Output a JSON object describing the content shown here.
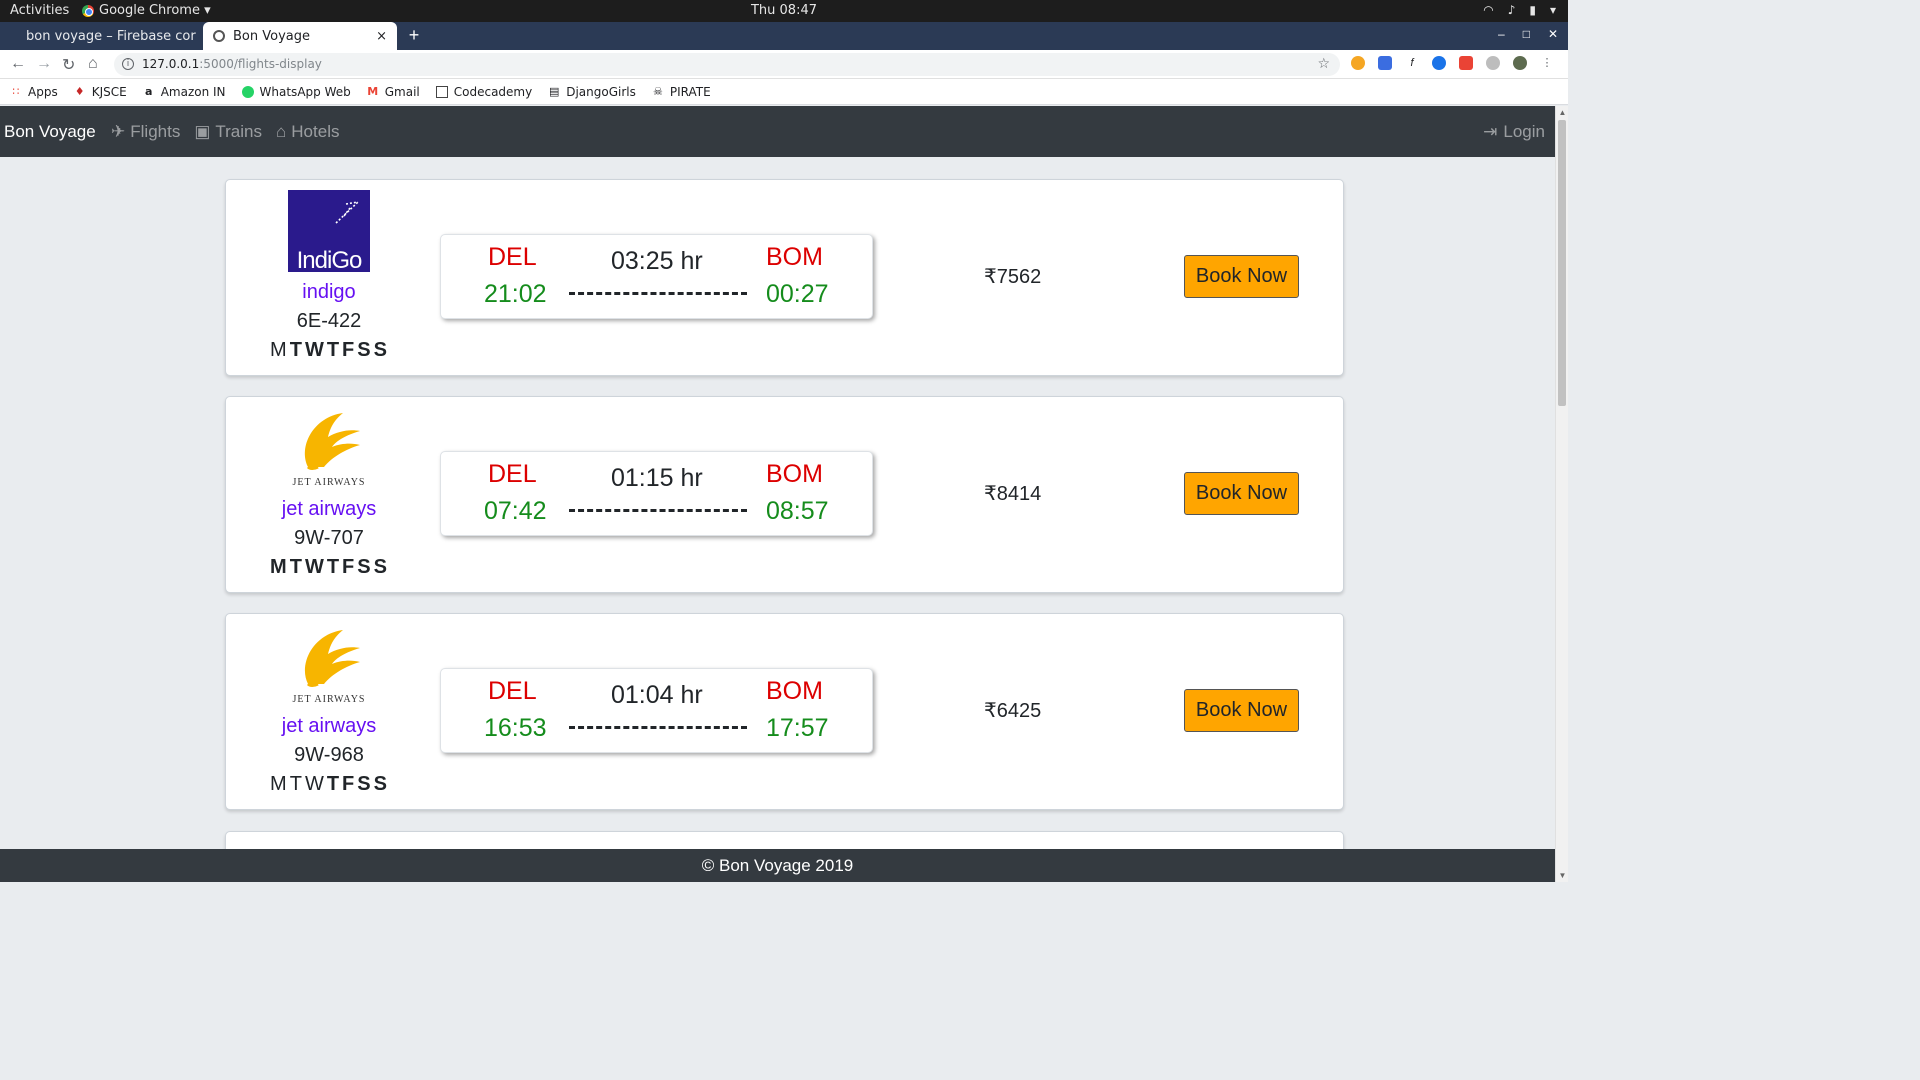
{
  "os_bar": {
    "activities": "Activities",
    "app_name": "Google Chrome ▾",
    "clock": "Thu 08:47"
  },
  "tabs": [
    {
      "title": "bon voyage – Firebase cor",
      "close": "×"
    },
    {
      "title": "Bon Voyage",
      "close": "×"
    }
  ],
  "address_bar": {
    "host": "127.0.0.1",
    "path": ":5000/flights-display"
  },
  "bookmarks": [
    {
      "label": "Apps",
      "icon": "apps-grid-icon"
    },
    {
      "label": "KJSCE",
      "icon": "kjsce-icon"
    },
    {
      "label": "Amazon IN",
      "icon": "amazon-icon"
    },
    {
      "label": "WhatsApp Web",
      "icon": "whatsapp-icon"
    },
    {
      "label": "Gmail",
      "icon": "gmail-icon"
    },
    {
      "label": "Codecademy",
      "icon": "codecademy-icon"
    },
    {
      "label": "DjangoGirls",
      "icon": "book-icon"
    },
    {
      "label": "PIRATE",
      "icon": "pirate-icon"
    }
  ],
  "navbar": {
    "brand": "Bon Voyage",
    "links": [
      {
        "label": "Flights",
        "icon": "plane-icon"
      },
      {
        "label": "Trains",
        "icon": "train-icon"
      },
      {
        "label": "Hotels",
        "icon": "home-icon"
      }
    ],
    "login": "Login"
  },
  "day_letters": [
    "M",
    "T",
    "W",
    "T",
    "F",
    "S",
    "S"
  ],
  "flights": [
    {
      "airline": "indigo",
      "logo": "indigo-logo",
      "logo_text": "IndiGo",
      "code": "6E-422",
      "days_active": [
        false,
        true,
        true,
        true,
        true,
        true,
        true
      ],
      "from": "DEL",
      "to": "BOM",
      "dep": "21:02",
      "arr": "00:27",
      "duration": "03:25 hr",
      "price": "₹7562",
      "book": "Book Now"
    },
    {
      "airline": "jet airways",
      "logo": "jet-airways-logo",
      "logo_text": "JET AIRWAYS",
      "code": "9W-707",
      "days_active": [
        true,
        true,
        true,
        true,
        true,
        true,
        true
      ],
      "from": "DEL",
      "to": "BOM",
      "dep": "07:42",
      "arr": "08:57",
      "duration": "01:15 hr",
      "price": "₹8414",
      "book": "Book Now"
    },
    {
      "airline": "jet airways",
      "logo": "jet-airways-logo",
      "logo_text": "JET AIRWAYS",
      "code": "9W-968",
      "days_active": [
        false,
        false,
        false,
        true,
        true,
        true,
        true
      ],
      "from": "DEL",
      "to": "BOM",
      "dep": "16:53",
      "arr": "17:57",
      "duration": "01:04 hr",
      "price": "₹6425",
      "book": "Book Now"
    }
  ],
  "footer": "© Bon Voyage 2019",
  "colors": {
    "navbar": "#343a40",
    "book_button": "#ffa500",
    "airport": "#dc0000",
    "time": "#158c1c",
    "airline_name": "#6610f2"
  }
}
